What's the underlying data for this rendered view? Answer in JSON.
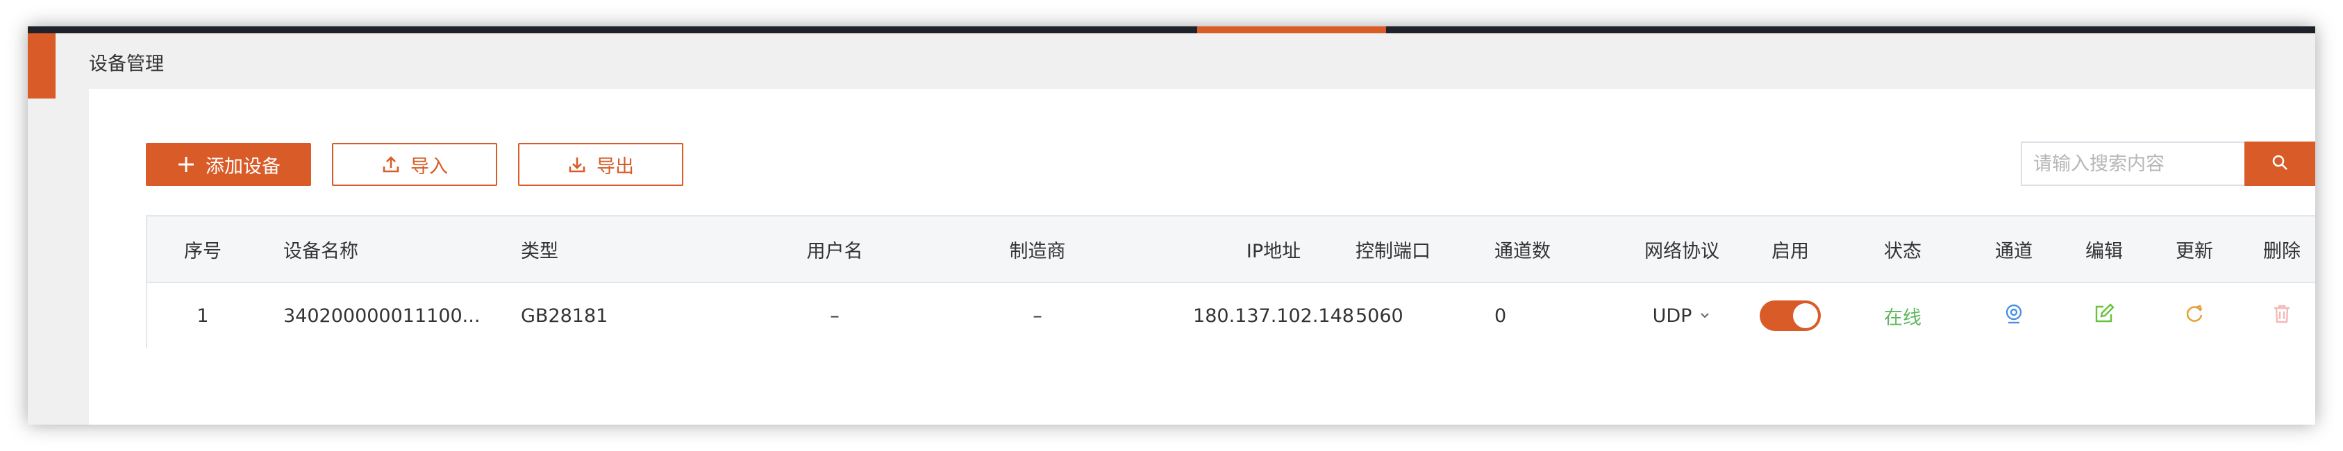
{
  "page": {
    "title": "设备管理"
  },
  "toolbar": {
    "add_label": "添加设备",
    "import_label": "导入",
    "export_label": "导出"
  },
  "search": {
    "placeholder": "请输入搜索内容"
  },
  "table": {
    "headers": [
      "序号",
      "设备名称",
      "类型",
      "用户名",
      "制造商",
      "IP地址",
      "控制端口",
      "通道数",
      "网络协议",
      "启用",
      "状态",
      "通道",
      "编辑",
      "更新",
      "删除"
    ],
    "rows": [
      {
        "index": "1",
        "name": "340200000011100...",
        "type": "GB28181",
        "username": "–",
        "manufacturer": "–",
        "ip": "180.137.102.148",
        "port": "5060",
        "channels": "0",
        "protocol": "UDP",
        "enabled": true,
        "status": "在线"
      }
    ]
  },
  "colors": {
    "accent": "#d95b27",
    "online": "#5cb85c",
    "channel_icon": "#4a90e2",
    "edit_icon": "#67c23a",
    "refresh_icon": "#e6a23c",
    "delete_icon": "#f4b8b8"
  },
  "icons": {
    "add": "plus-icon",
    "import": "upload-icon",
    "export": "download-icon",
    "search": "search-icon",
    "channel": "camera-icon",
    "edit": "edit-icon",
    "refresh": "refresh-icon",
    "delete": "trash-icon",
    "protocol_dropdown": "chevron-down-icon"
  }
}
